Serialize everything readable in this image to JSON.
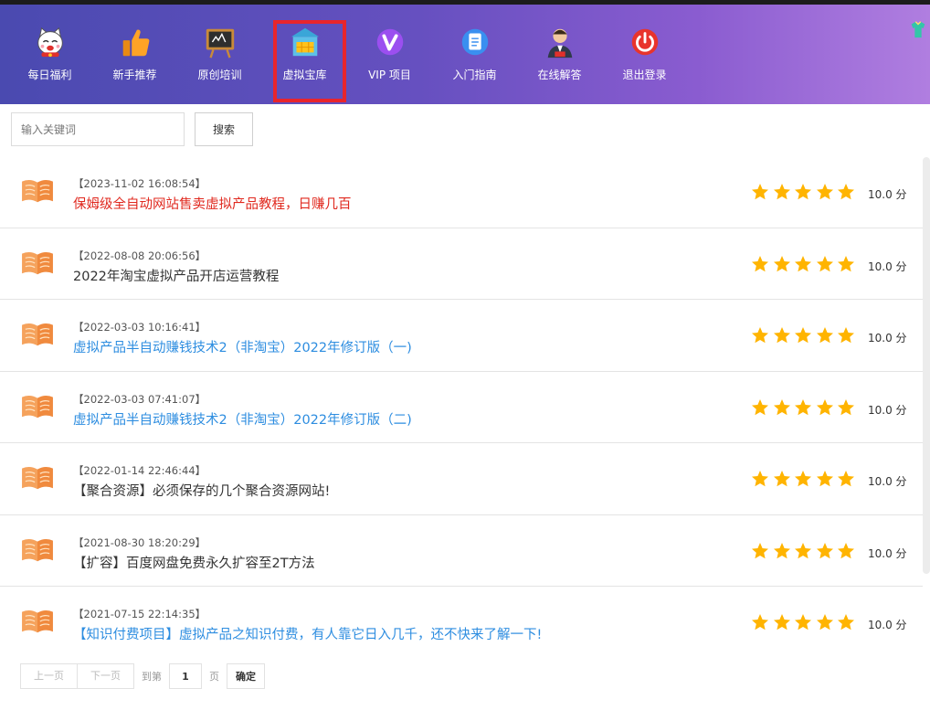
{
  "nav": [
    {
      "label": "每日福利",
      "icon": "lucky-cat-icon"
    },
    {
      "label": "新手推荐",
      "icon": "thumbs-up-icon"
    },
    {
      "label": "原创培训",
      "icon": "blackboard-icon"
    },
    {
      "label": "虚拟宝库",
      "icon": "treasure-house-icon",
      "active": true
    },
    {
      "label": "VIP 项目",
      "icon": "vip-icon"
    },
    {
      "label": "入门指南",
      "icon": "guide-document-icon"
    },
    {
      "label": "在线解答",
      "icon": "customer-service-icon"
    },
    {
      "label": "退出登录",
      "icon": "power-icon"
    }
  ],
  "search": {
    "placeholder": "输入关键词",
    "button": "搜索"
  },
  "items": [
    {
      "date": "【2023-11-02 16:08:54】",
      "title": "保姆级全自动网站售卖虚拟产品教程，日赚几百",
      "color": "red",
      "rating": 5,
      "score": "10.0 分"
    },
    {
      "date": "【2022-08-08 20:06:56】",
      "title": "2022年淘宝虚拟产品开店运营教程",
      "color": "default",
      "rating": 5,
      "score": "10.0 分"
    },
    {
      "date": "【2022-03-03 10:16:41】",
      "title": "虚拟产品半自动赚钱技术2（非淘宝）2022年修订版（一)",
      "color": "blue",
      "rating": 5,
      "score": "10.0 分"
    },
    {
      "date": "【2022-03-03 07:41:07】",
      "title": "虚拟产品半自动赚钱技术2（非淘宝）2022年修订版（二)",
      "color": "blue",
      "rating": 5,
      "score": "10.0 分"
    },
    {
      "date": "【2022-01-14 22:46:44】",
      "title": "【聚合资源】必须保存的几个聚合资源网站!",
      "color": "default",
      "rating": 5,
      "score": "10.0 分"
    },
    {
      "date": "【2021-08-30 18:20:29】",
      "title": "【扩容】百度网盘免费永久扩容至2T方法",
      "color": "default",
      "rating": 5,
      "score": "10.0 分"
    },
    {
      "date": "【2021-07-15 22:14:35】",
      "title": "【知识付费项目】虚拟产品之知识付费，有人靠它日入几千，还不快来了解一下!",
      "color": "blue",
      "rating": 5,
      "score": "10.0 分"
    }
  ],
  "pager": {
    "prev": "上一页",
    "next": "下一页",
    "goto": "到第",
    "page": "1",
    "page_unit": "页",
    "confirm": "确定"
  },
  "colors": {
    "red_title": "#e0281e",
    "blue_title": "#2d8de0",
    "star": "#ffb400",
    "active_border": "#e8252c"
  }
}
